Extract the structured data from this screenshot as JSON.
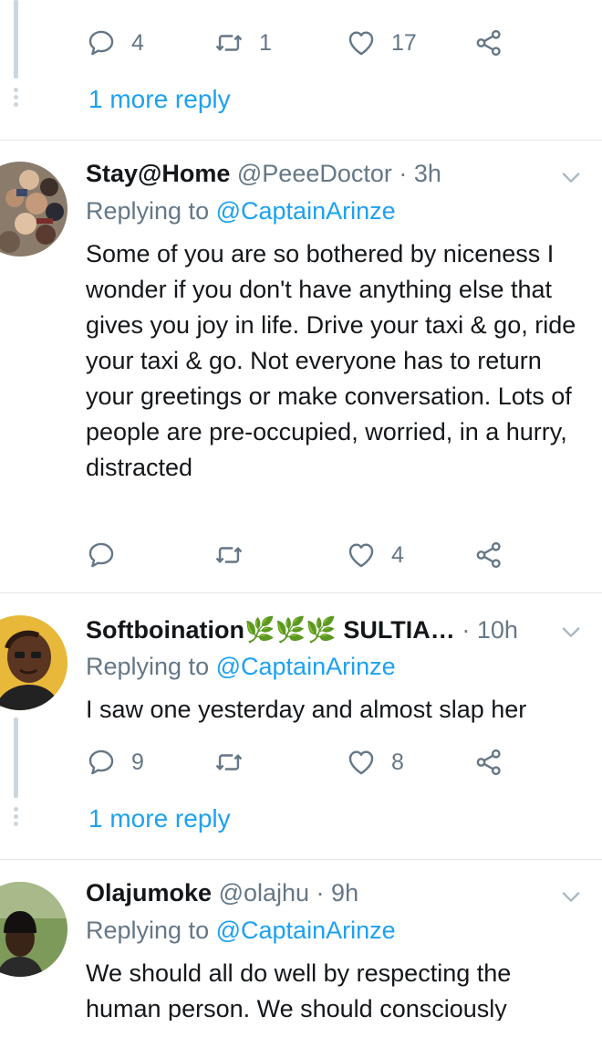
{
  "top_tweet": {
    "stats": {
      "replies": "4",
      "retweets": "1",
      "likes": "17"
    },
    "more_reply": "1 more reply"
  },
  "tweets": [
    {
      "name": "Stay@Home",
      "handle": "@PeeeDoctor",
      "time": "3h",
      "replying_prefix": "Replying to",
      "replying_to": "@CaptainArinze",
      "text": "Some of you are so bothered by niceness I wonder if you don't have anything else that gives you joy in life. Drive your taxi & go, ride your taxi & go. Not everyone has to return your greetings or make conversation. Lots of people are pre-occupied, worried, in a hurry, distracted",
      "stats": {
        "replies": "",
        "retweets": "",
        "likes": "4"
      }
    },
    {
      "name": "Softboination🌿🌿🌿 SULTIA…",
      "handle": "",
      "time": "10h",
      "replying_prefix": "Replying to",
      "replying_to": "@CaptainArinze",
      "text": "I saw one yesterday and almost slap her",
      "stats": {
        "replies": "9",
        "retweets": "",
        "likes": "8"
      },
      "more_reply": "1 more reply"
    },
    {
      "name": "Olajumoke",
      "handle": "@olajhu",
      "time": "9h",
      "replying_prefix": "Replying to",
      "replying_to": "@CaptainArinze",
      "text": "We should all do well by  respecting the human person. We should consciously"
    }
  ],
  "icons": {
    "reply": "reply-icon",
    "retweet": "retweet-icon",
    "like": "heart-icon",
    "share": "share-icon",
    "menu": "chevron-down-icon"
  },
  "colors": {
    "link": "#1da1f2",
    "muted": "#657786",
    "text": "#14171a",
    "thread_line": "#ccd6dd",
    "divider": "#e1e8ed"
  }
}
